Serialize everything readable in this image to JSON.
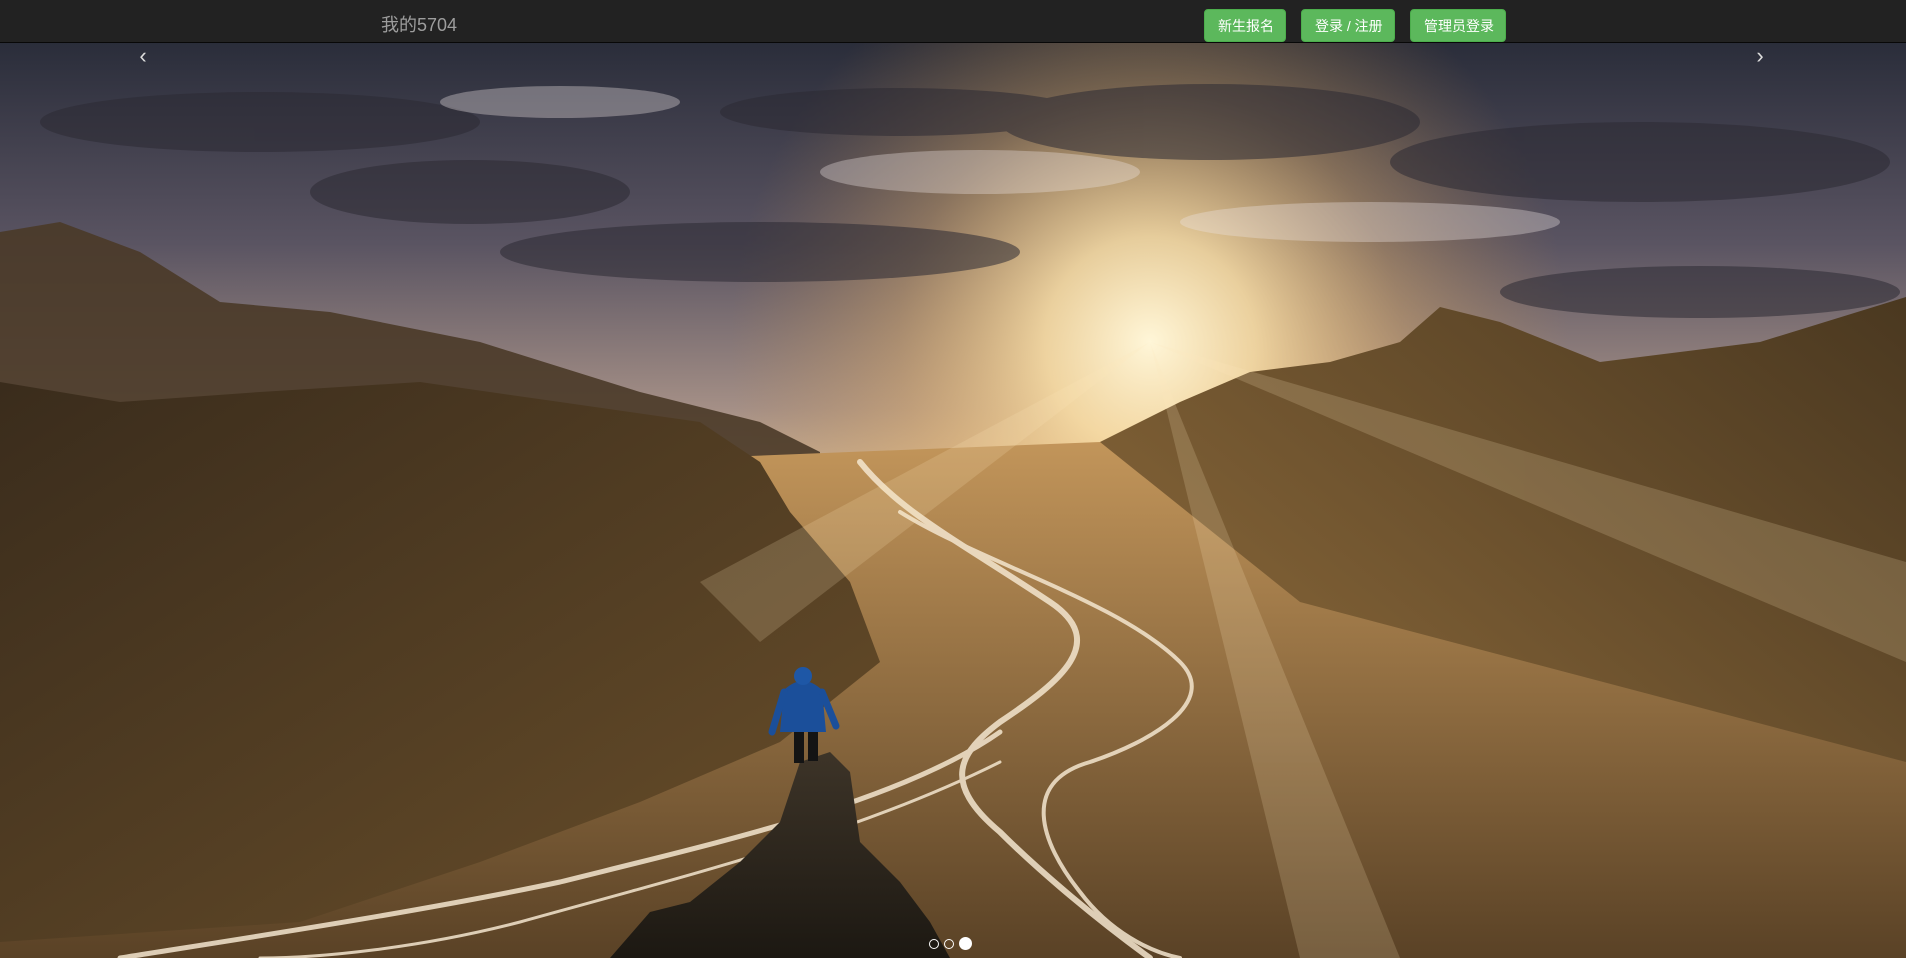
{
  "navbar": {
    "brand": "我的5704",
    "buttons": {
      "register": "新生报名",
      "login": "登录 / 注册",
      "admin": "管理员登录"
    },
    "colors": {
      "background": "#222222",
      "brand_text": "#9d9d9d",
      "button_bg": "#5cb85c",
      "button_text": "#ffffff"
    }
  },
  "carousel": {
    "prev_icon": "‹",
    "next_icon": "›",
    "slide_count": 3,
    "active_slide": 3,
    "slide_description_icon": "hiker-on-rock-sunrise-valley-image"
  }
}
